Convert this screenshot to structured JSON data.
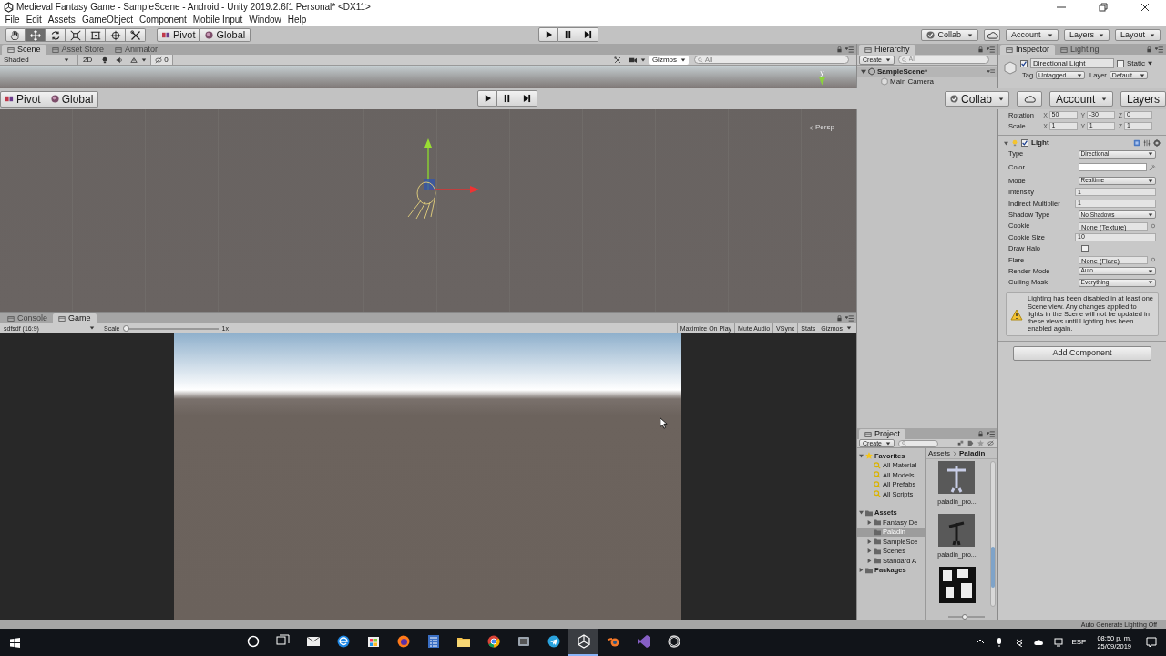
{
  "window": {
    "title": "Medieval Fantasy Game - SampleScene - Android - Unity 2019.2.6f1 Personal* <DX11>"
  },
  "menu": [
    "File",
    "Edit",
    "Assets",
    "GameObject",
    "Component",
    "Mobile Input",
    "Window",
    "Help"
  ],
  "toolbar": {
    "tools": [
      {
        "kind": "hand",
        "selected": false
      },
      {
        "kind": "move",
        "selected": true
      },
      {
        "kind": "rotate",
        "selected": false
      },
      {
        "kind": "scale",
        "selected": false
      },
      {
        "kind": "rect",
        "selected": false
      },
      {
        "kind": "transform",
        "selected": false
      },
      {
        "kind": "custom",
        "selected": false
      }
    ],
    "pivot": "Pivot",
    "global": "Global",
    "collab": "Collab",
    "account": "Account",
    "layers": "Layers",
    "layout": "Layout"
  },
  "scene": {
    "tabs": [
      {
        "label": "Scene",
        "selected": true
      },
      {
        "label": "Asset Store",
        "selected": false
      },
      {
        "label": "Animator",
        "selected": false
      }
    ],
    "shading": "Shaded",
    "mode_2d": "2D",
    "toggles": [
      {
        "kind": "lighting",
        "on": false
      },
      {
        "kind": "audio",
        "on": false
      },
      {
        "kind": "effects",
        "on": false
      }
    ],
    "tools_button": {
      "on": false
    },
    "hidden_count": "0",
    "gizmos": "Gizmos",
    "search": {
      "placeholder": "All"
    },
    "axis_label": "y",
    "projection": "Persp"
  },
  "overlay_toolbar": {
    "pivot": "Pivot",
    "global": "Global",
    "collab": "Collab",
    "account": "Account",
    "layers": "Layers"
  },
  "game": {
    "tabs": [
      {
        "label": "Console",
        "selected": false
      },
      {
        "label": "Game",
        "selected": true
      }
    ],
    "aspect": "sdfsdf (16:9)",
    "scale_label": "Scale",
    "scale": {
      "level": 0
    },
    "scale_value": "1x",
    "toggles": [
      {
        "label": "Maximize On Play",
        "on": false
      },
      {
        "label": "Mute Audio",
        "on": false
      },
      {
        "label": "VSync",
        "on": false
      },
      {
        "label": "Stats",
        "on": false
      }
    ],
    "gizmos": "Gizmos"
  },
  "hierarchy": {
    "title": "Hierarchy",
    "create": "Create",
    "search": {
      "placeholder": "All"
    },
    "items": [
      {
        "label": "SampleScene*",
        "kind": "scene",
        "expanded": true,
        "children": [
          {
            "label": "Main Camera",
            "kind": "object"
          }
        ]
      }
    ]
  },
  "inspector": {
    "tabs": [
      {
        "label": "Inspector",
        "selected": true
      },
      {
        "label": "Lighting",
        "selected": false
      }
    ],
    "object": {
      "active": true,
      "name": "Directional Light",
      "static_label": "Static",
      "static": false,
      "tag_label": "Tag",
      "tag": "Untagged",
      "layer_label": "Layer",
      "layer": "Default"
    },
    "transform": [
      {
        "label": "Rotation",
        "values": [
          {
            "axis": "X",
            "value": "50"
          },
          {
            "axis": "Y",
            "value": "-30"
          },
          {
            "axis": "Z",
            "value": "0"
          }
        ]
      },
      {
        "label": "Scale",
        "values": [
          {
            "axis": "X",
            "value": "1"
          },
          {
            "axis": "Y",
            "value": "1"
          },
          {
            "axis": "Z",
            "value": "1"
          }
        ]
      }
    ],
    "light": {
      "title": "Light",
      "enabled": true,
      "expanded": true,
      "fields": [
        {
          "kind": "dropdown",
          "label": "Type",
          "value": "Directional"
        },
        {
          "kind": "color",
          "label": "Color",
          "color": "#ffffff"
        },
        {
          "kind": "dropdown",
          "label": "Mode",
          "value": "Realtime"
        },
        {
          "kind": "text",
          "label": "Intensity",
          "value": "1"
        },
        {
          "kind": "text",
          "label": "Indirect Multiplier",
          "value": "1"
        },
        {
          "kind": "dropdown",
          "label": "Shadow Type",
          "value": "No Shadows"
        },
        {
          "kind": "object",
          "label": "Cookie",
          "value": "None (Texture)"
        },
        {
          "kind": "text",
          "label": "Cookie Size",
          "value": "10"
        },
        {
          "kind": "checkbox",
          "label": "Draw Halo",
          "checked": false
        },
        {
          "kind": "object",
          "label": "Flare",
          "value": "None (Flare)"
        },
        {
          "kind": "dropdown",
          "label": "Render Mode",
          "value": "Auto"
        },
        {
          "kind": "dropdown",
          "label": "Culling Mask",
          "value": "Everything"
        }
      ]
    },
    "warning": "Lighting has been disabled in at least one Scene view. Any changes applied to lights in the Scene will not be updated in these views until Lighting has been enabled again.",
    "add_component": "Add Component"
  },
  "project": {
    "title": "Project",
    "create": "Create",
    "tree": [
      {
        "label": "Favorites",
        "kind": "favorites",
        "expanded": true,
        "children": [
          {
            "label": "All Material",
            "kind": "search"
          },
          {
            "label": "All Models",
            "kind": "search"
          },
          {
            "label": "All Prefabs",
            "kind": "search"
          },
          {
            "label": "All Scripts",
            "kind": "search"
          }
        ]
      },
      {
        "label": "Assets",
        "kind": "root",
        "expanded": true,
        "children": [
          {
            "label": "Fantasy De",
            "kind": "folder",
            "expanded": false
          },
          {
            "label": "Paladin",
            "kind": "folder",
            "selected": true
          },
          {
            "label": "SampleSce",
            "kind": "folder",
            "expanded": false
          },
          {
            "label": "Scenes",
            "kind": "folder",
            "expanded": false
          },
          {
            "label": "Standard A",
            "kind": "folder",
            "expanded": false
          }
        ]
      },
      {
        "label": "Packages",
        "kind": "root",
        "expanded": false
      }
    ],
    "breadcrumb": [
      "Assets",
      "Paladin"
    ],
    "zoom": {
      "level": 0.45
    },
    "assets": [
      {
        "kind": "model",
        "label": "paladin_pro..."
      },
      {
        "kind": "animation",
        "label": "paladin_pro..."
      },
      {
        "kind": "texture"
      }
    ]
  },
  "status_bar": "Auto Generate Lighting Off",
  "taskbar": {
    "apps": [
      {
        "kind": "cortana",
        "active": false
      },
      {
        "kind": "taskview",
        "active": false
      },
      {
        "kind": "mail",
        "active": false
      },
      {
        "kind": "edge",
        "active": false
      },
      {
        "kind": "store",
        "active": false
      },
      {
        "kind": "firefox",
        "active": false
      },
      {
        "kind": "calculator",
        "active": false
      },
      {
        "kind": "explorer",
        "active": false
      },
      {
        "kind": "chrome",
        "active": false
      },
      {
        "kind": "app",
        "active": false
      },
      {
        "kind": "telegram",
        "active": false
      },
      {
        "kind": "unity",
        "active": true
      },
      {
        "kind": "blender",
        "active": false
      },
      {
        "kind": "visualstudio",
        "active": false
      },
      {
        "kind": "hub",
        "active": false
      }
    ],
    "language": "ESP",
    "time": "08:50 p. m.",
    "date": "25/09/2019"
  }
}
